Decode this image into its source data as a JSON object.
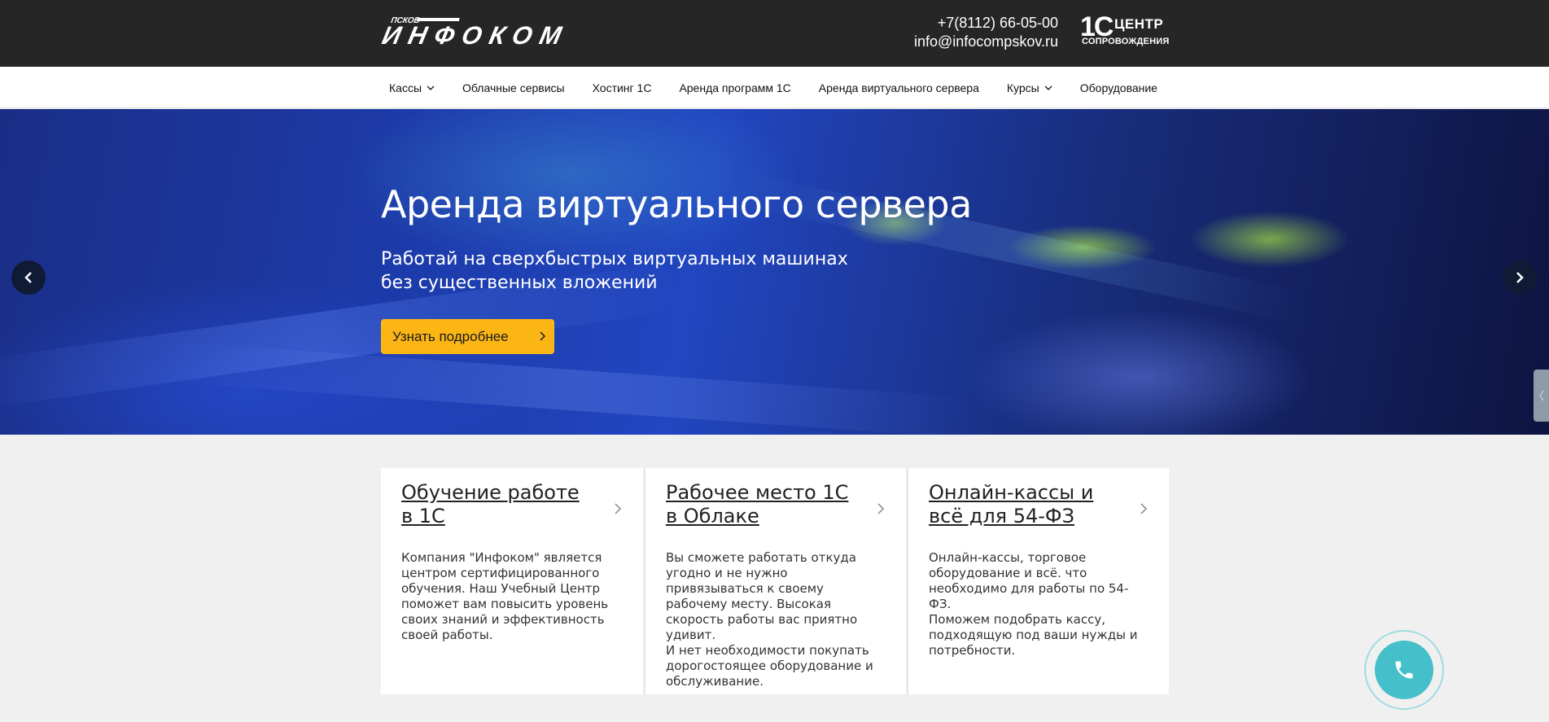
{
  "header": {
    "logo_text": "ИНФОКОМ",
    "logo_small": "ПСКОВ",
    "phone": "+7(8112) 66-05-00",
    "email": "info@infocompskov.ru",
    "partner": {
      "big": "1С",
      "line1": "ЦЕНТР",
      "line2": "СОПРОВОЖДЕНИЯ"
    }
  },
  "nav": {
    "items": [
      {
        "label": "Кассы",
        "dropdown": true
      },
      {
        "label": "Облачные сервисы",
        "dropdown": false
      },
      {
        "label": "Хостинг 1С",
        "dropdown": false
      },
      {
        "label": "Аренда программ 1С",
        "dropdown": false
      },
      {
        "label": "Аренда виртуального сервера",
        "dropdown": false
      },
      {
        "label": "Курсы",
        "dropdown": true
      },
      {
        "label": "Оборудование",
        "dropdown": false
      }
    ]
  },
  "hero": {
    "title": "Аренда виртуального сервера",
    "subtitle_line1": "Работай на сверхбыстрых виртуальных машинах",
    "subtitle_line2": "без существенных вложений",
    "cta_label": "Узнать подробнее",
    "accent": "#fbb615"
  },
  "cards": [
    {
      "title": "Обучение работе в 1С",
      "text": "Компания \"Инфоком\" является центром сертифицированного обучения. Наш Учебный Центр поможет вам повысить уровень своих знаний и эффективность своей работы."
    },
    {
      "title": "Рабочее место 1С в Облаке",
      "text": "Вы сможете работать откуда угодно и не нужно привязываться к своему рабочему месту. Высокая скорость работы вас приятно удивит.\nИ нет необходимости покупать дорогостоящее оборудование и обслуживание."
    },
    {
      "title": "Онлайн-кассы и всё для 54-ФЗ",
      "text": "Онлайн-кассы, торговое оборудование и всё. что необходимо для работы по 54-ФЗ.\nПоможем подобрать кассу, подходящую под ваши нужды и потребности."
    }
  ],
  "widget": {
    "icon": "phone-icon",
    "color": "#45bfc9"
  }
}
